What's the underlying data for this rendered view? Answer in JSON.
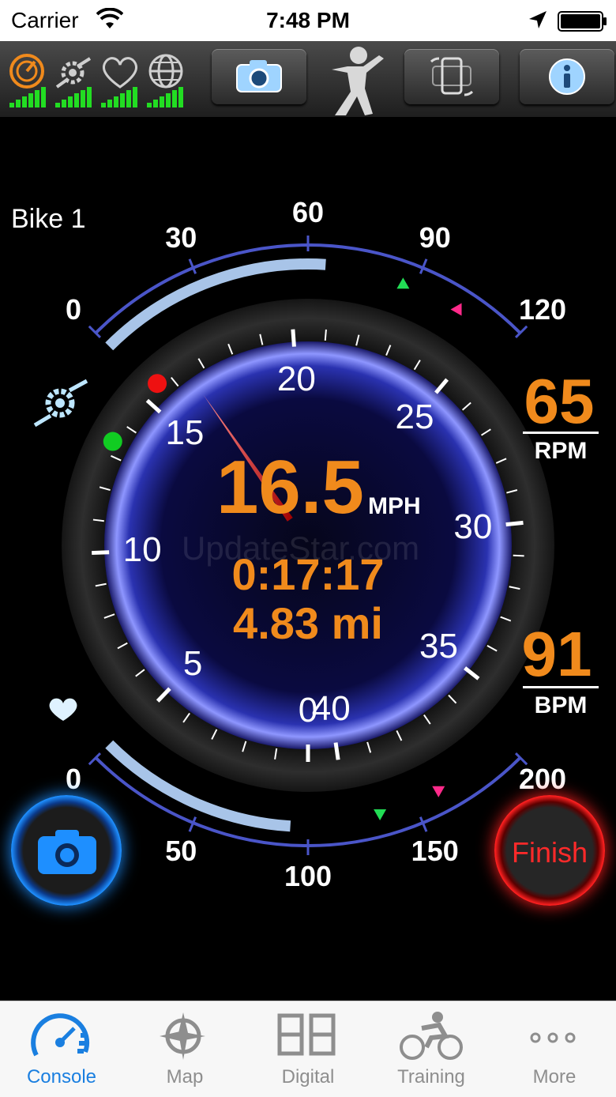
{
  "status_bar": {
    "carrier": "Carrier",
    "time": "7:48 PM"
  },
  "toolbar": {
    "sensors": [
      {
        "icon": "speed-sensor-icon",
        "color": "#f08a1c"
      },
      {
        "icon": "cadence-sensor-icon",
        "color": "#cfcfcf"
      },
      {
        "icon": "heart-sensor-icon",
        "color": "#cfcfcf"
      },
      {
        "icon": "gps-globe-icon",
        "color": "#cfcfcf"
      }
    ],
    "signal_color": "#22dd22",
    "buttons": [
      "camera-icon",
      "app-logo-icon",
      "rotate-device-icon",
      "info-icon"
    ]
  },
  "bike_label": "Bike 1",
  "cadence": {
    "scale": [
      "0",
      "30",
      "60",
      "90",
      "120"
    ],
    "value": "65",
    "unit": "RPM",
    "fill_fraction": 0.54
  },
  "heart_rate": {
    "scale": [
      "0",
      "50",
      "100",
      "150",
      "200"
    ],
    "value": "91",
    "unit": "BPM",
    "fill_fraction": 0.46
  },
  "speedometer": {
    "scale": [
      "0",
      "5",
      "10",
      "15",
      "20",
      "25",
      "30",
      "35",
      "40"
    ],
    "speed": "16.5",
    "speed_unit": "MPH",
    "elapsed_time": "0:17:17",
    "distance": "4.83 mi"
  },
  "watermark": "UpdateStar.com",
  "buttons": {
    "finish": "Finish"
  },
  "colors": {
    "accent_orange": "#f08a1c",
    "tab_active": "#1a7fe0",
    "gauge_blue": "#5560e0"
  },
  "tabs": [
    {
      "label": "Console",
      "icon": "speedometer-icon",
      "active": true
    },
    {
      "label": "Map",
      "icon": "map-compass-icon",
      "active": false
    },
    {
      "label": "Digital",
      "icon": "digital-display-icon",
      "active": false
    },
    {
      "label": "Training",
      "icon": "cyclist-icon",
      "active": false
    },
    {
      "label": "More",
      "icon": "more-dots-icon",
      "active": false
    }
  ]
}
